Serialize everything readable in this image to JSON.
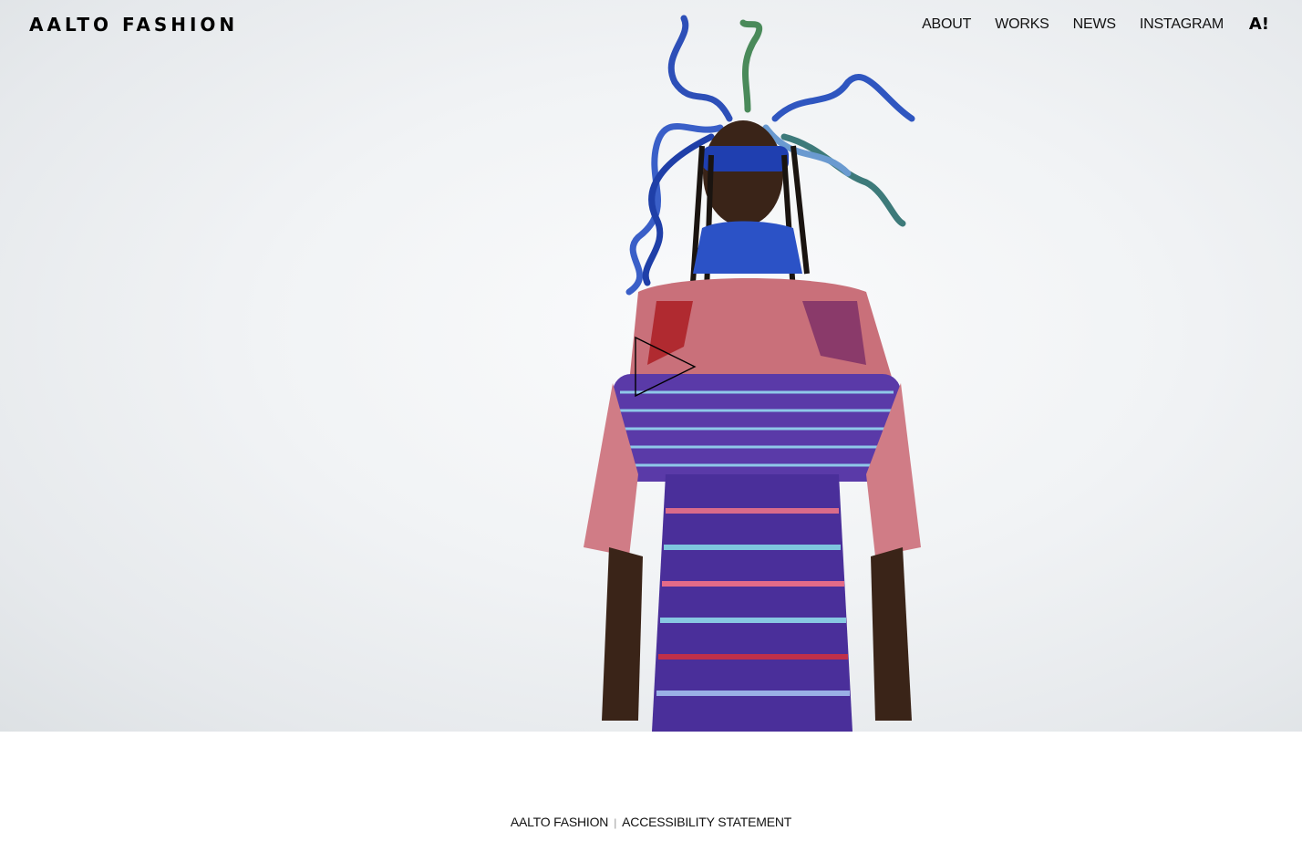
{
  "header": {
    "logo": "AALTO FASHION",
    "nav": [
      "ABOUT",
      "WORKS",
      "NEWS",
      "INSTAGRAM"
    ],
    "brand_mark": "A!"
  },
  "hero": {
    "play_icon": "play-icon",
    "background_color": "#eef0f2"
  },
  "footer": {
    "home_link": "AALTO FASHION",
    "separator": "|",
    "accessibility_link": "ACCESSIBILITY STATEMENT"
  }
}
